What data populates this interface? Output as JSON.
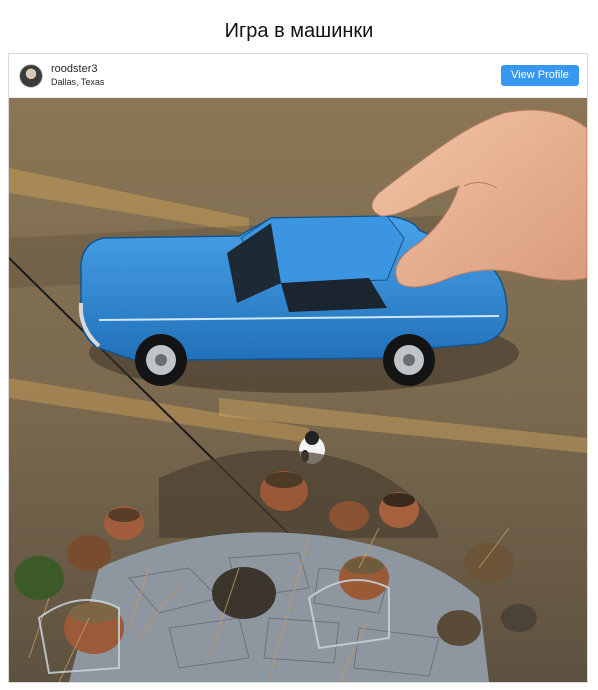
{
  "page": {
    "title": "Игра в машинки"
  },
  "post": {
    "username": "roodster3",
    "location": "Dallas, Texas",
    "view_profile_label": "View Profile",
    "photo_icon": "photo-image",
    "accent_color": "#3897f0",
    "car_color": "#2f86d6"
  }
}
